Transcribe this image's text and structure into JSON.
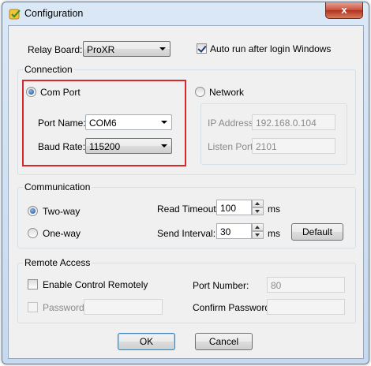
{
  "window": {
    "title": "Configuration",
    "close_glyph": "x",
    "icon": "app-config-icon"
  },
  "top": {
    "relay_board_label": "Relay Board:",
    "relay_board_value": "ProXR",
    "auto_run_label": "Auto run after login Windows",
    "auto_run_checked": true
  },
  "connection": {
    "group_title": "Connection",
    "com_port_label": "Com Port",
    "com_port_selected": true,
    "port_name_label": "Port Name:",
    "port_name_value": "COM6",
    "baud_rate_label": "Baud Rate:",
    "baud_rate_value": "115200",
    "network_label": "Network",
    "network_selected": false,
    "ip_address_label": "IP Address:",
    "ip_address_value": "192.168.0.104",
    "listen_port_label": "Listen Port:",
    "listen_port_value": "2101",
    "highlight_color": "#d9262b"
  },
  "communication": {
    "group_title": "Communication",
    "two_way_label": "Two-way",
    "two_way_selected": true,
    "one_way_label": "One-way",
    "one_way_selected": false,
    "read_timeout_label": "Read Timeout:",
    "read_timeout_value": "100",
    "read_timeout_unit": "ms",
    "send_interval_label": "Send Interval:",
    "send_interval_value": "30",
    "send_interval_unit": "ms",
    "default_button": "Default"
  },
  "remote_access": {
    "group_title": "Remote Access",
    "enable_label": "Enable Control Remotely",
    "enable_checked": false,
    "password_label": "Password:",
    "password_value": "",
    "port_number_label": "Port Number:",
    "port_number_value": "80",
    "confirm_password_label": "Confirm Password:",
    "confirm_password_value": ""
  },
  "buttons": {
    "ok": "OK",
    "cancel": "Cancel"
  }
}
